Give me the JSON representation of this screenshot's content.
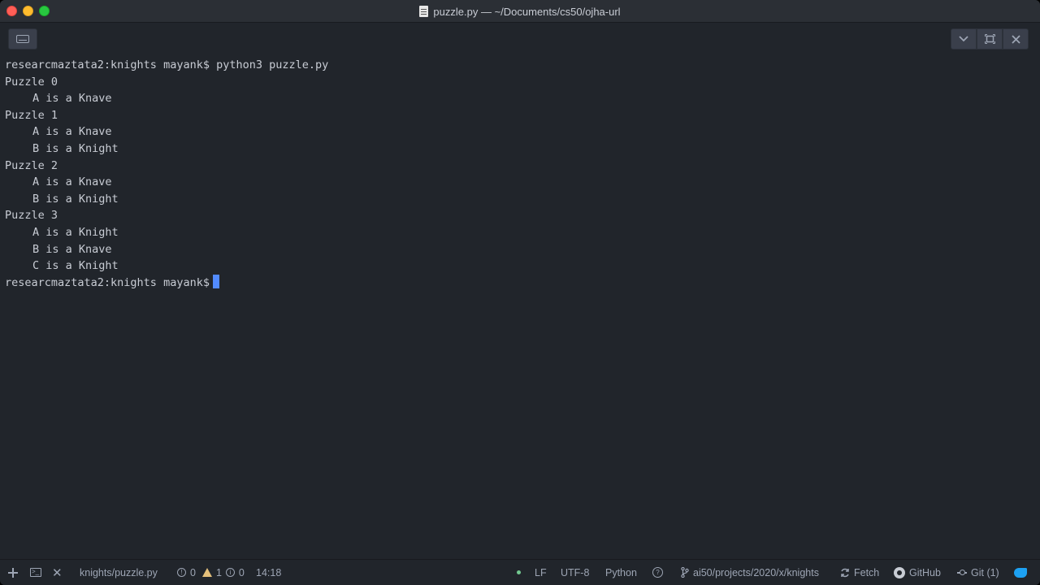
{
  "window": {
    "title": "puzzle.py — ~/Documents/cs50/ojha-url"
  },
  "terminal": {
    "prompt_command": "researcmaztata2:knights mayank$ python3 puzzle.py",
    "lines": [
      "Puzzle 0",
      "A is a Knave",
      "Puzzle 1",
      "A is a Knave",
      "B is a Knight",
      "Puzzle 2",
      "A is a Knave",
      "B is a Knight",
      "Puzzle 3",
      "A is a Knight",
      "B is a Knave",
      "C is a Knight"
    ],
    "prompt_final": "researcmaztata2:knights mayank$"
  },
  "statusbar": {
    "file_path": "knights/puzzle.py",
    "errors": "0",
    "warnings": "1",
    "infos": "0",
    "cursor_position": "14:18",
    "line_ending": "LF",
    "encoding": "UTF-8",
    "grammar": "Python",
    "branch": "ai50/projects/2020/x/knights",
    "fetch_label": "Fetch",
    "github_label": "GitHub",
    "git_label": "Git (1)"
  },
  "colors": {
    "background": "#21252b",
    "text": "#c8ccd4",
    "cursor": "#528bff",
    "warning": "#e5c07b"
  }
}
